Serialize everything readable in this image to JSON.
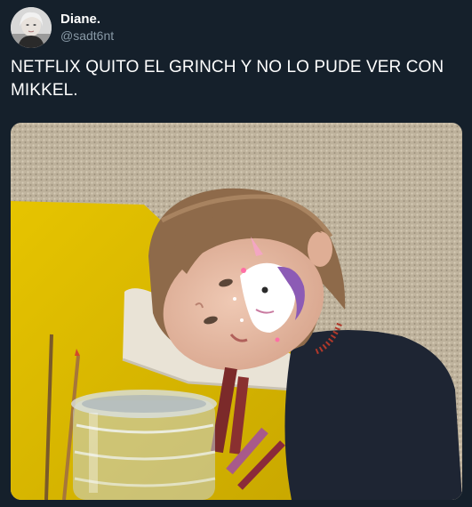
{
  "tweet": {
    "author": {
      "display_name": "Diane.",
      "handle": "@sadt6nt"
    },
    "text": "NETFLIX QUITO EL GRINCH Y NO LO PUDE VER CON MIKKEL.",
    "media": {
      "type": "photo"
    }
  },
  "icons": {
    "avatar": "profile-photo"
  }
}
